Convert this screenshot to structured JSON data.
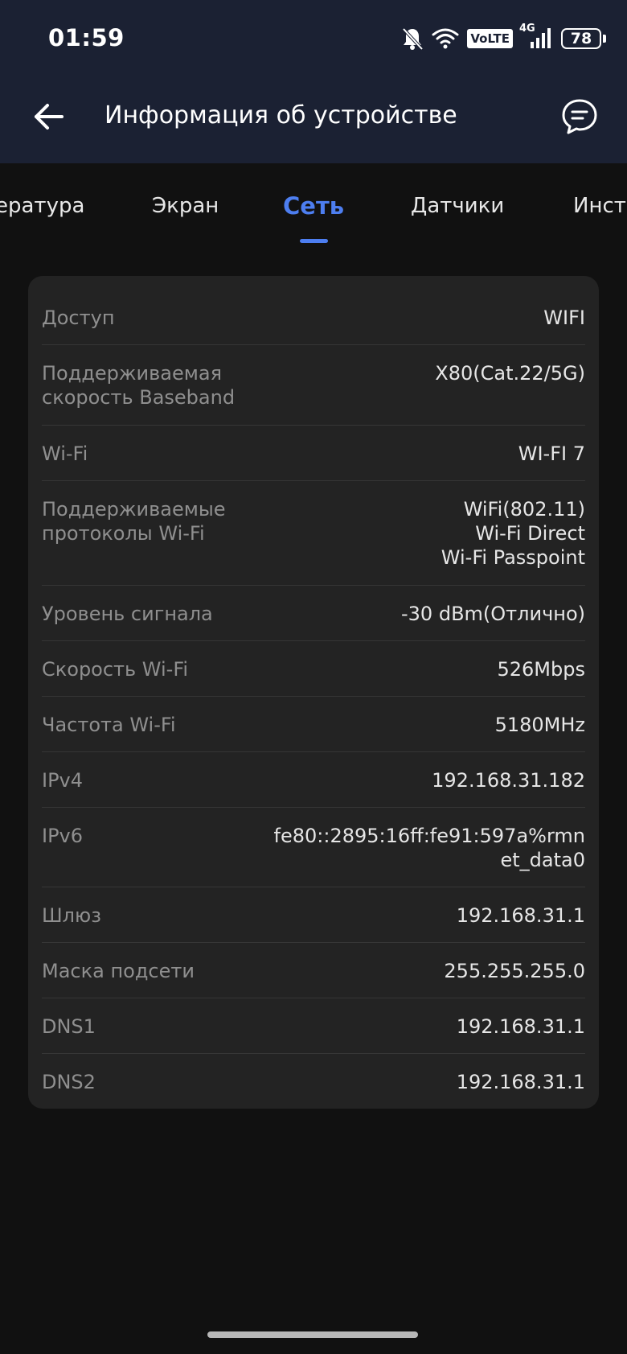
{
  "status_bar": {
    "time": "01:59",
    "volte_label": "VoLTE",
    "network_label": "4G",
    "battery": "78",
    "icons": [
      "bell-off-icon",
      "wifi-icon",
      "volte-icon",
      "signal-icon",
      "battery-icon"
    ]
  },
  "toolbar": {
    "title": "Информация об устройстве",
    "back_icon": "arrow-left-icon",
    "feedback_icon": "chat-bubble-icon"
  },
  "tabs": [
    {
      "label": "ература",
      "active": false
    },
    {
      "label": "Экран",
      "active": false
    },
    {
      "label": "Сеть",
      "active": true
    },
    {
      "label": "Датчики",
      "active": false
    },
    {
      "label": "Инстр",
      "active": false
    }
  ],
  "rows": [
    {
      "label": "Доступ",
      "value": "WIFI"
    },
    {
      "label": "Поддерживаемая скорость Baseband",
      "value": "X80(Cat.22/5G)"
    },
    {
      "label": "Wi-Fi",
      "value": "WI-FI 7"
    },
    {
      "label": "Поддерживаемые протоколы Wi-Fi",
      "value": "WiFi(802.11)\nWi-Fi Direct\nWi-Fi Passpoint"
    },
    {
      "label": "Уровень сигнала",
      "value": "-30 dBm(Отлично)"
    },
    {
      "label": "Скорость Wi-Fi",
      "value": "526Mbps"
    },
    {
      "label": "Частота Wi-Fi",
      "value": "5180MHz"
    },
    {
      "label": "IPv4",
      "value": "192.168.31.182"
    },
    {
      "label": "IPv6",
      "value": "fe80::2895:16ff:fe91:597a%rmnet_data0"
    },
    {
      "label": "Шлюз",
      "value": "192.168.31.1"
    },
    {
      "label": "Маска подсети",
      "value": "255.255.255.0"
    },
    {
      "label": "DNS1",
      "value": "192.168.31.1"
    },
    {
      "label": "DNS2",
      "value": "192.168.31.1"
    }
  ],
  "colors": {
    "header_bg": "#1b2133",
    "accent": "#4d7ef0",
    "card_bg": "#232323",
    "page_bg": "#111111"
  }
}
